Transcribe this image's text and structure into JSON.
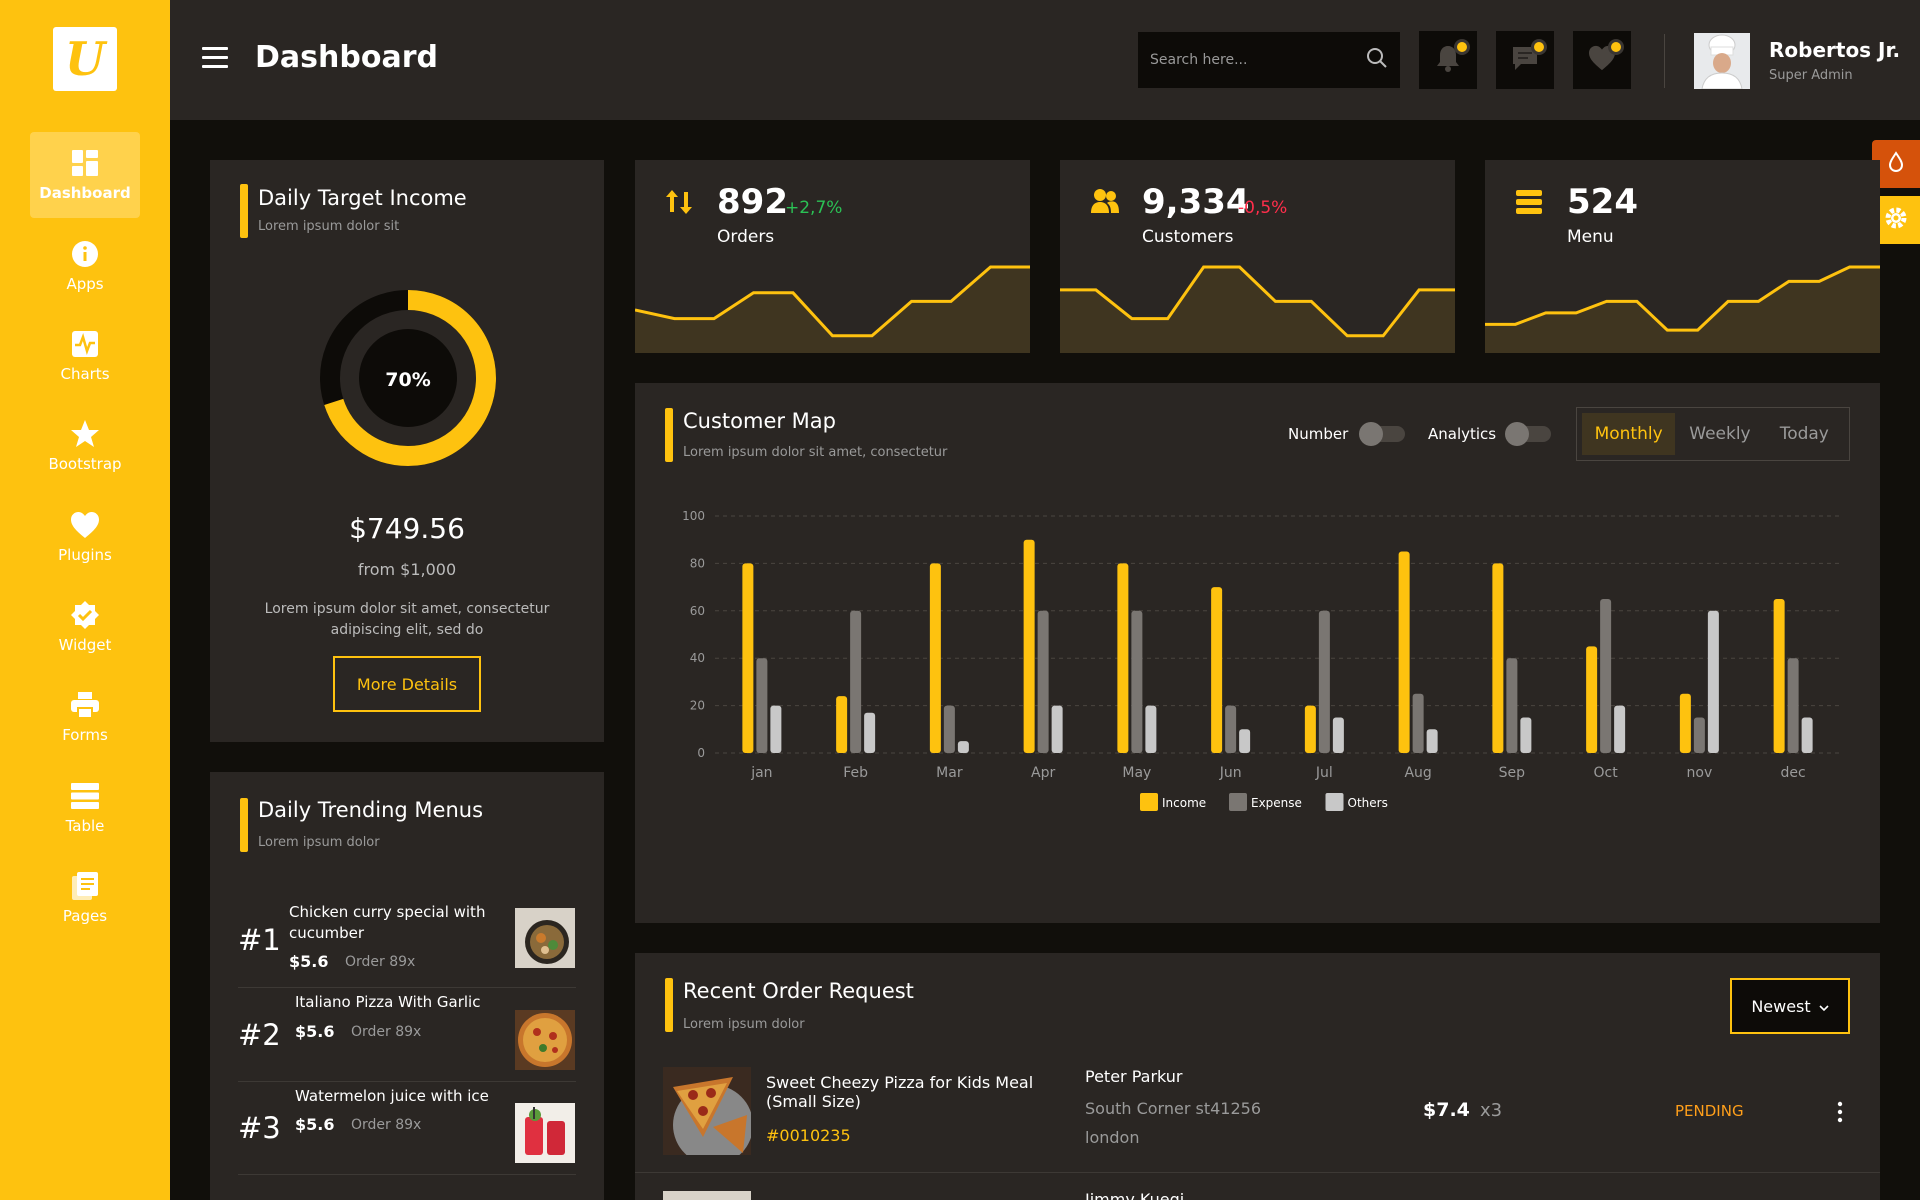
{
  "app": {
    "logo_letter": "U"
  },
  "sidebar": {
    "items": [
      {
        "label": "Dashboard",
        "icon": "dashboard-icon"
      },
      {
        "label": "Apps",
        "icon": "info-icon"
      },
      {
        "label": "Charts",
        "icon": "chart-icon"
      },
      {
        "label": "Bootstrap",
        "icon": "star-icon"
      },
      {
        "label": "Plugins",
        "icon": "heart-icon"
      },
      {
        "label": "Widget",
        "icon": "widget-icon"
      },
      {
        "label": "Forms",
        "icon": "printer-icon"
      },
      {
        "label": "Table",
        "icon": "table-icon"
      },
      {
        "label": "Pages",
        "icon": "pages-icon"
      }
    ]
  },
  "header": {
    "title": "Dashboard",
    "search_placeholder": "Search here...",
    "user": {
      "name": "Robertos Jr.",
      "role": "Super Admin"
    }
  },
  "daily_target": {
    "title": "Daily Target Income",
    "subtitle": "Lorem ipsum dolor sit",
    "percent_label": "70%",
    "progress": 0.7,
    "amount": "$749.56",
    "from": "from $1,000",
    "description": "Lorem ipsum dolor sit amet, consectetur adipiscing elit, sed do",
    "button": "More Details"
  },
  "stats": [
    {
      "value": "892",
      "delta": "+2,7%",
      "label": "Orders",
      "delta_color": "#2bc155",
      "spark": [
        30,
        24,
        24,
        42,
        42,
        12,
        12,
        36,
        36,
        60,
        60
      ]
    },
    {
      "value": "9,334",
      "delta": "-0,5%",
      "label": "Customers",
      "delta_color": "#ff2e4b",
      "spark": [
        44,
        44,
        24,
        24,
        60,
        60,
        36,
        36,
        12,
        12,
        44,
        44
      ]
    },
    {
      "value": "524",
      "delta": "",
      "label": "Menu",
      "delta_color": "#2bc155",
      "spark": [
        20,
        20,
        28,
        28,
        36,
        36,
        16,
        16,
        36,
        36,
        50,
        50,
        60,
        60
      ]
    }
  ],
  "trending": {
    "title": "Daily Trending Menus",
    "subtitle": "Lorem ipsum dolor",
    "items": [
      {
        "rank": "#1",
        "name": "Chicken curry special with cucumber",
        "price": "$5.6",
        "orders": "Order 89x"
      },
      {
        "rank": "#2",
        "name": "Italiano Pizza With Garlic",
        "price": "$5.6",
        "orders": "Order 89x"
      },
      {
        "rank": "#3",
        "name": "Watermelon juice with ice",
        "price": "$5.6",
        "orders": "Order 89x"
      }
    ]
  },
  "customer_map": {
    "title": "Customer Map",
    "subtitle": "Lorem ipsum dolor sit amet, consectetur",
    "toggle_number": "Number",
    "toggle_analytics": "Analytics",
    "periods": [
      "Monthly",
      "Weekly",
      "Today"
    ]
  },
  "chart_data": {
    "type": "bar",
    "categories": [
      "jan",
      "Feb",
      "Mar",
      "Apr",
      "May",
      "Jun",
      "Jul",
      "Aug",
      "Sep",
      "Oct",
      "nov",
      "dec"
    ],
    "series": [
      {
        "name": "Income",
        "color": "#fec20f",
        "values": [
          80,
          24,
          80,
          90,
          80,
          70,
          20,
          85,
          80,
          45,
          25,
          65
        ]
      },
      {
        "name": "Expense",
        "color": "#7a7672",
        "values": [
          40,
          60,
          20,
          60,
          60,
          20,
          60,
          25,
          40,
          65,
          15,
          40
        ]
      },
      {
        "name": "Others",
        "color": "#c8c8c8",
        "values": [
          20,
          17,
          5,
          20,
          20,
          10,
          15,
          10,
          15,
          20,
          60,
          15
        ]
      }
    ],
    "ylim": [
      0,
      100
    ],
    "yticks": [
      0,
      20,
      40,
      60,
      80,
      100
    ],
    "grid": true,
    "legend": "bottom"
  },
  "recent_orders": {
    "title": "Recent Order Request",
    "subtitle": "Lorem ipsum dolor",
    "sort": "Newest",
    "rows": [
      {
        "item": "Sweet Cheezy Pizza for Kids Meal (Small Size)",
        "id": "#0010235",
        "customer": "Peter Parkur",
        "address_line1": "South Corner st41256",
        "address_line2": "london",
        "price": "$7.4",
        "qty": "x3",
        "status": "PENDING"
      },
      {
        "customer_partial": "Jimmy Kuegi"
      }
    ]
  }
}
